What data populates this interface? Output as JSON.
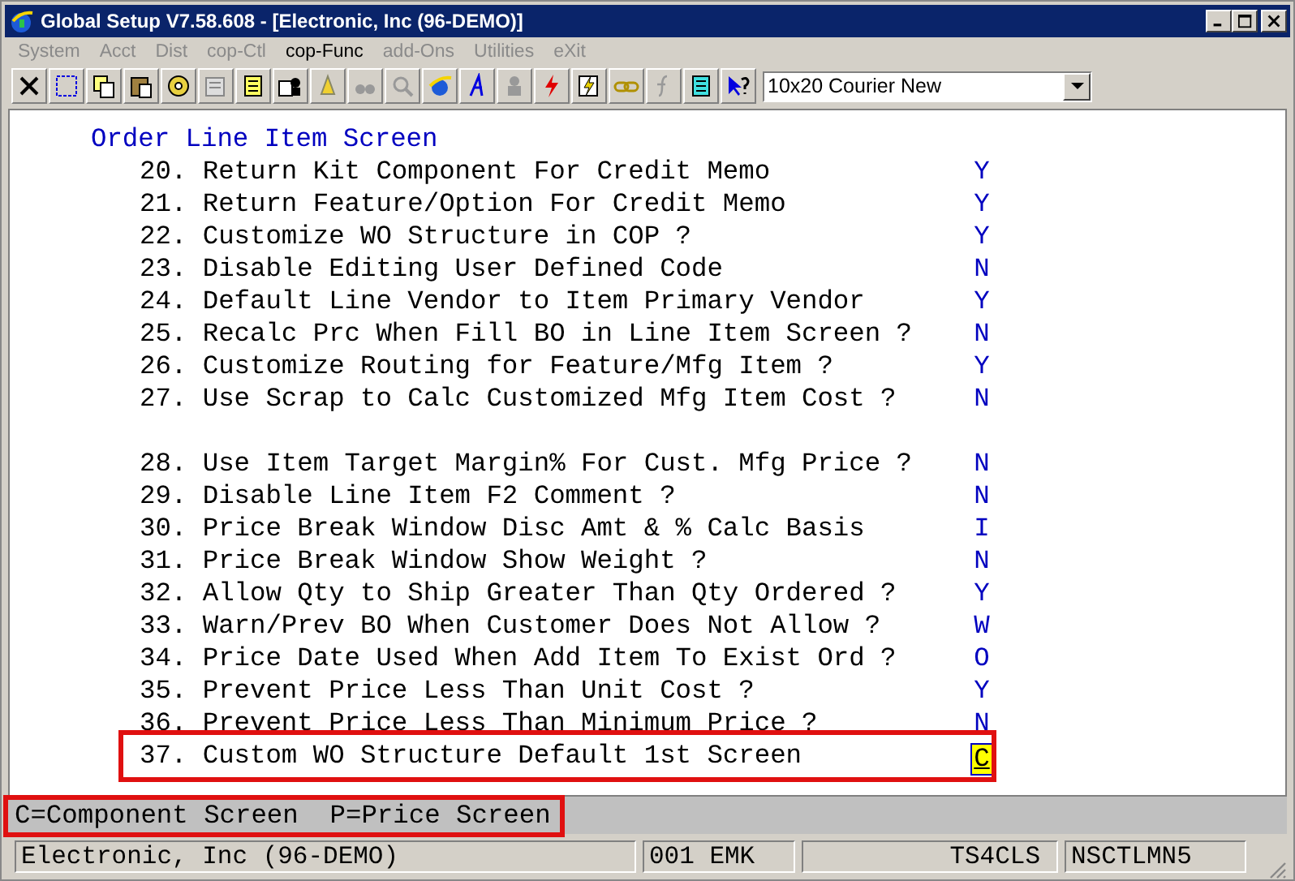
{
  "window": {
    "title": "Global Setup V7.58.608 - [Electronic, Inc (96-DEMO)]"
  },
  "menu": [
    {
      "label": "System",
      "disabled": true
    },
    {
      "label": "Acct",
      "disabled": true
    },
    {
      "label": "Dist",
      "disabled": true
    },
    {
      "label": "cop-Ctl",
      "disabled": true
    },
    {
      "label": "cop-Func",
      "disabled": false
    },
    {
      "label": "add-Ons",
      "disabled": true
    },
    {
      "label": "Utilities",
      "disabled": true
    },
    {
      "label": "eXit",
      "disabled": true
    }
  ],
  "font_select": {
    "value": "10x20 Courier New"
  },
  "screen": {
    "heading": "Order Line Item Screen",
    "sections": [
      {
        "items": [
          {
            "label": "20. Return Kit Component For Credit Memo",
            "value": "Y",
            "current": false,
            "highlighted": false
          },
          {
            "label": "21. Return Feature/Option For Credit Memo",
            "value": "Y",
            "current": false,
            "highlighted": false
          },
          {
            "label": "22. Customize WO Structure in COP ?",
            "value": "Y",
            "current": false,
            "highlighted": false
          },
          {
            "label": "23. Disable Editing User Defined Code",
            "value": "N",
            "current": false,
            "highlighted": false
          },
          {
            "label": "24. Default Line Vendor to Item Primary Vendor",
            "value": "Y",
            "current": false,
            "highlighted": false
          },
          {
            "label": "25. Recalc Prc When Fill BO in Line Item Screen ?",
            "value": "N",
            "current": false,
            "highlighted": false
          },
          {
            "label": "26. Customize Routing for Feature/Mfg Item ?",
            "value": "Y",
            "current": false,
            "highlighted": false
          },
          {
            "label": "27. Use Scrap to Calc Customized Mfg Item Cost ?",
            "value": "N",
            "current": false,
            "highlighted": false
          }
        ]
      },
      {
        "items": [
          {
            "label": "28. Use Item Target Margin% For Cust. Mfg Price ?",
            "value": "N",
            "current": false,
            "highlighted": false
          },
          {
            "label": "29. Disable Line Item F2 Comment ?",
            "value": "N",
            "current": false,
            "highlighted": false
          },
          {
            "label": "30. Price Break Window Disc Amt & % Calc Basis",
            "value": "I",
            "current": false,
            "highlighted": false
          },
          {
            "label": "31. Price Break Window Show Weight ?",
            "value": "N",
            "current": false,
            "highlighted": false
          },
          {
            "label": "32. Allow Qty to Ship Greater Than Qty Ordered ?",
            "value": "Y",
            "current": false,
            "highlighted": false
          },
          {
            "label": "33. Warn/Prev BO When Customer Does Not Allow ?",
            "value": "W",
            "current": false,
            "highlighted": false
          },
          {
            "label": "34. Price Date Used When Add Item To Exist Ord ?",
            "value": "O",
            "current": false,
            "highlighted": false
          },
          {
            "label": "35. Prevent Price Less Than Unit Cost ?",
            "value": "Y",
            "current": false,
            "highlighted": false
          },
          {
            "label": "36. Prevent Price Less Than Minimum Price ?",
            "value": "N",
            "current": false,
            "highlighted": false
          },
          {
            "label": "37. Custom WO Structure Default 1st Screen",
            "value": "C",
            "current": true,
            "highlighted": true
          }
        ]
      }
    ]
  },
  "hint": {
    "text": "C=Component Screen  P=Price Screen",
    "highlighted": true
  },
  "status_bar": [
    "Electronic, Inc (96-DEMO)",
    "001 EMK",
    "TS4CLS",
    "NSCTLMN5"
  ]
}
